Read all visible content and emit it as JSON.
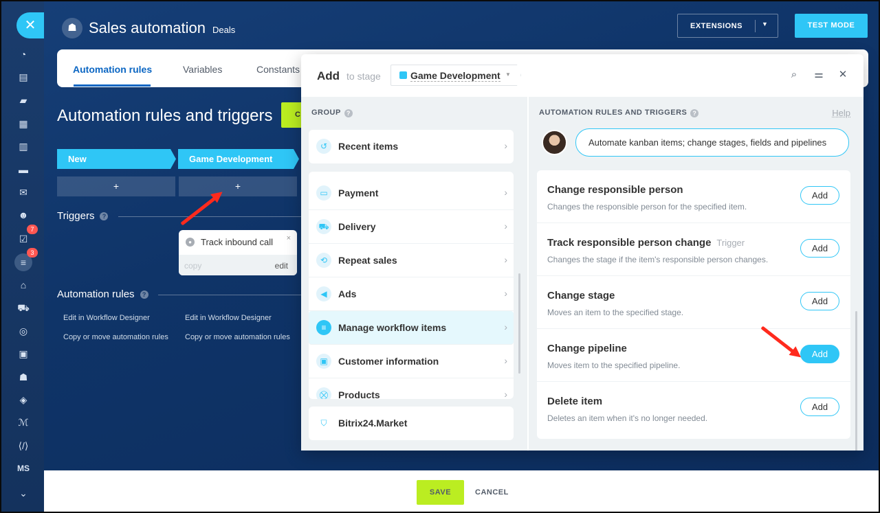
{
  "header": {
    "title": "Sales automation",
    "subtitle": "Deals",
    "extensions_label": "EXTENSIONS",
    "test_mode_label": "TEST MODE"
  },
  "sidebar": {
    "badges": [
      "7",
      "3"
    ],
    "ms_label": "MS"
  },
  "tabs": [
    {
      "label": "Automation rules",
      "active": true
    },
    {
      "label": "Variables",
      "active": false
    },
    {
      "label": "Constants",
      "active": false
    }
  ],
  "background": {
    "page_title": "Automation rules and triggers",
    "green_button_fragment": "C",
    "stages": [
      "New",
      "Game Development"
    ],
    "plus": "+",
    "triggers_label": "Triggers",
    "help_mark": "?",
    "trigger_card": {
      "title": "Track inbound call",
      "copy": "copy",
      "edit": "edit",
      "close": "×"
    },
    "automation_rules_label": "Automation rules",
    "links": [
      "Edit in Workflow Designer",
      "Copy or move automation rules"
    ]
  },
  "modal": {
    "add_label": "Add",
    "to_stage_label": "to stage",
    "stage_name": "Game Development",
    "group_header": "GROUP",
    "groups_top": [
      {
        "label": "Recent items",
        "icon": "clock-icon"
      }
    ],
    "groups": [
      {
        "label": "Payment",
        "icon": "wallet-icon",
        "active": false
      },
      {
        "label": "Delivery",
        "icon": "truck-icon",
        "active": false
      },
      {
        "label": "Repeat sales",
        "icon": "cart-repeat-icon",
        "active": false
      },
      {
        "label": "Ads",
        "icon": "megaphone-icon",
        "active": false
      },
      {
        "label": "Manage workflow items",
        "icon": "filter-icon",
        "active": true
      },
      {
        "label": "Customer information",
        "icon": "contact-card-icon",
        "active": false
      },
      {
        "label": "Products",
        "icon": "cart-icon",
        "active": false
      }
    ],
    "market_label": "Bitrix24.Market",
    "rules_header": "AUTOMATION RULES AND TRIGGERS",
    "help_label": "Help",
    "bubble_text": "Automate kanban items; change stages, fields and pipelines",
    "rules": [
      {
        "title": "Change responsible person",
        "tag": "",
        "desc": "Changes the responsible person for the specified item.",
        "add": "Add",
        "highlight": false
      },
      {
        "title": "Track responsible person change",
        "tag": "Trigger",
        "desc": "Changes the stage if the item's responsible person changes.",
        "add": "Add",
        "highlight": false
      },
      {
        "title": "Change stage",
        "tag": "",
        "desc": "Moves an item to the specified stage.",
        "add": "Add",
        "highlight": false
      },
      {
        "title": "Change pipeline",
        "tag": "",
        "desc": "Moves item to the specified pipeline.",
        "add": "Add",
        "highlight": true
      },
      {
        "title": "Delete item",
        "tag": "",
        "desc": "Deletes an item when it's no longer needed.",
        "add": "Add",
        "highlight": false
      }
    ]
  },
  "footer": {
    "save_label": "SAVE",
    "cancel_label": "CANCEL"
  },
  "colors": {
    "accent": "#2fc6f6",
    "save_green": "#bbed21",
    "link_blue": "#0b66c3",
    "arrow_red": "#ff2a1d"
  }
}
